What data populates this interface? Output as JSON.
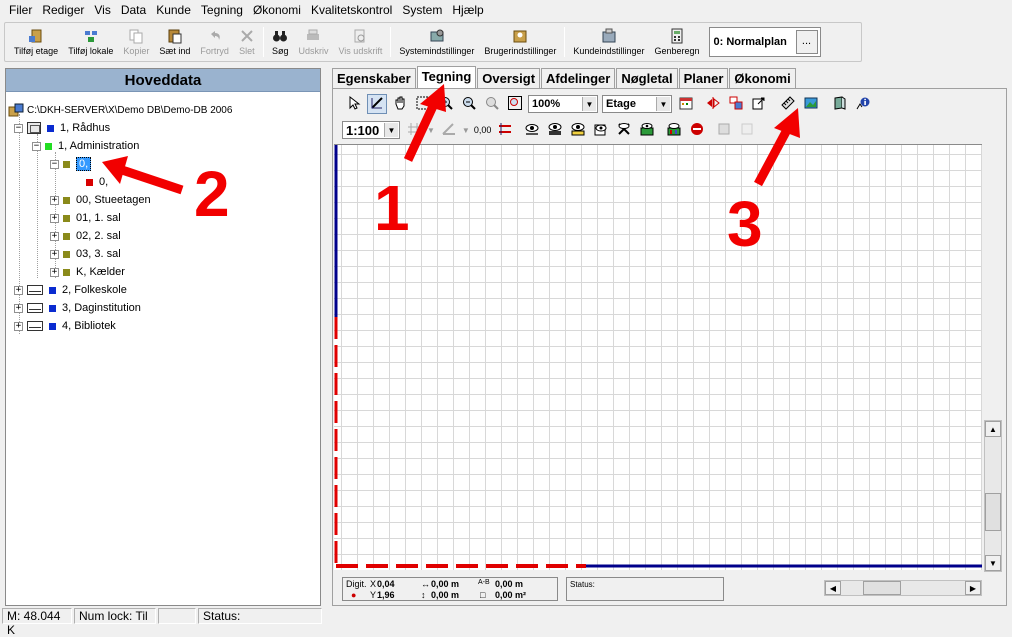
{
  "menu": [
    "Filer",
    "Rediger",
    "Vis",
    "Data",
    "Kunde",
    "Tegning",
    "Økonomi",
    "Kvalitetskontrol",
    "System",
    "Hjælp"
  ],
  "toolbar": {
    "buttons": [
      {
        "label": "Tilføj etage",
        "icon": "add-floor-icon",
        "enabled": true
      },
      {
        "label": "Tilføj lokale",
        "icon": "add-room-icon",
        "enabled": true
      },
      {
        "label": "Kopier",
        "icon": "copy-icon",
        "enabled": false
      },
      {
        "label": "Sæt ind",
        "icon": "paste-icon",
        "enabled": true
      },
      {
        "label": "Fortryd",
        "icon": "undo-icon",
        "enabled": false
      },
      {
        "label": "Slet",
        "icon": "delete-icon",
        "enabled": false
      },
      {
        "label": "Søg",
        "icon": "binoculars-icon",
        "enabled": true
      },
      {
        "label": "Udskriv",
        "icon": "print-icon",
        "enabled": false
      },
      {
        "label": "Vis udskrift",
        "icon": "print-preview-icon",
        "enabled": false
      },
      {
        "label": "Systemindstillinger",
        "icon": "system-settings-icon",
        "enabled": true
      },
      {
        "label": "Brugerindstillinger",
        "icon": "user-settings-icon",
        "enabled": true
      },
      {
        "label": "Kundeindstillinger",
        "icon": "customer-settings-icon",
        "enabled": true
      },
      {
        "label": "Genberegn",
        "icon": "recalculate-icon",
        "enabled": true
      }
    ],
    "plan_select": "0: Normalplan",
    "plan_more": "..."
  },
  "left_panel": {
    "title": "Hoveddata",
    "root": "C:\\DKH-SERVER\\X\\Demo DB\\Demo-DB 2006",
    "nodes": [
      {
        "label": "1, Rådhus"
      },
      {
        "label": "1, Administration"
      },
      {
        "label": "0,"
      },
      {
        "label": "0,"
      },
      {
        "label": "00, Stueetagen"
      },
      {
        "label": "01, 1. sal"
      },
      {
        "label": "02, 2. sal"
      },
      {
        "label": "03, 3. sal"
      },
      {
        "label": "K, Kælder"
      },
      {
        "label": "2, Folkeskole"
      },
      {
        "label": "3, Daginstitution"
      },
      {
        "label": "4, Bibliotek"
      }
    ]
  },
  "tabs": [
    "Egenskaber",
    "Tegning",
    "Oversigt",
    "Afdelinger",
    "Nøgletal",
    "Planer",
    "Økonomi"
  ],
  "active_tab": "Tegning",
  "draw_toolbar": {
    "zoom": "100%",
    "level": "Etage",
    "scale": "1:100",
    "small_value": "0,00"
  },
  "coords": {
    "digit_label": "Digit.",
    "x_label": "X",
    "x": "0,04",
    "y_label": "Y",
    "y": "1,96",
    "len1": "0,00 m",
    "len2": "0,00 m",
    "a_label": "A-B",
    "ab": "0,00 m",
    "area": "0,00 m²"
  },
  "draw_status_label": "Status:",
  "statusbar": {
    "memory": "M: 48.044 K",
    "numlock": "Num lock: Til",
    "blank": "",
    "status": "Status:"
  },
  "annotations": [
    "1",
    "2",
    "3"
  ],
  "colors": {
    "accent": "#9ab3cf",
    "selection": "#3399ff",
    "annotation": "#f20000",
    "plan_line": "#00008b"
  }
}
